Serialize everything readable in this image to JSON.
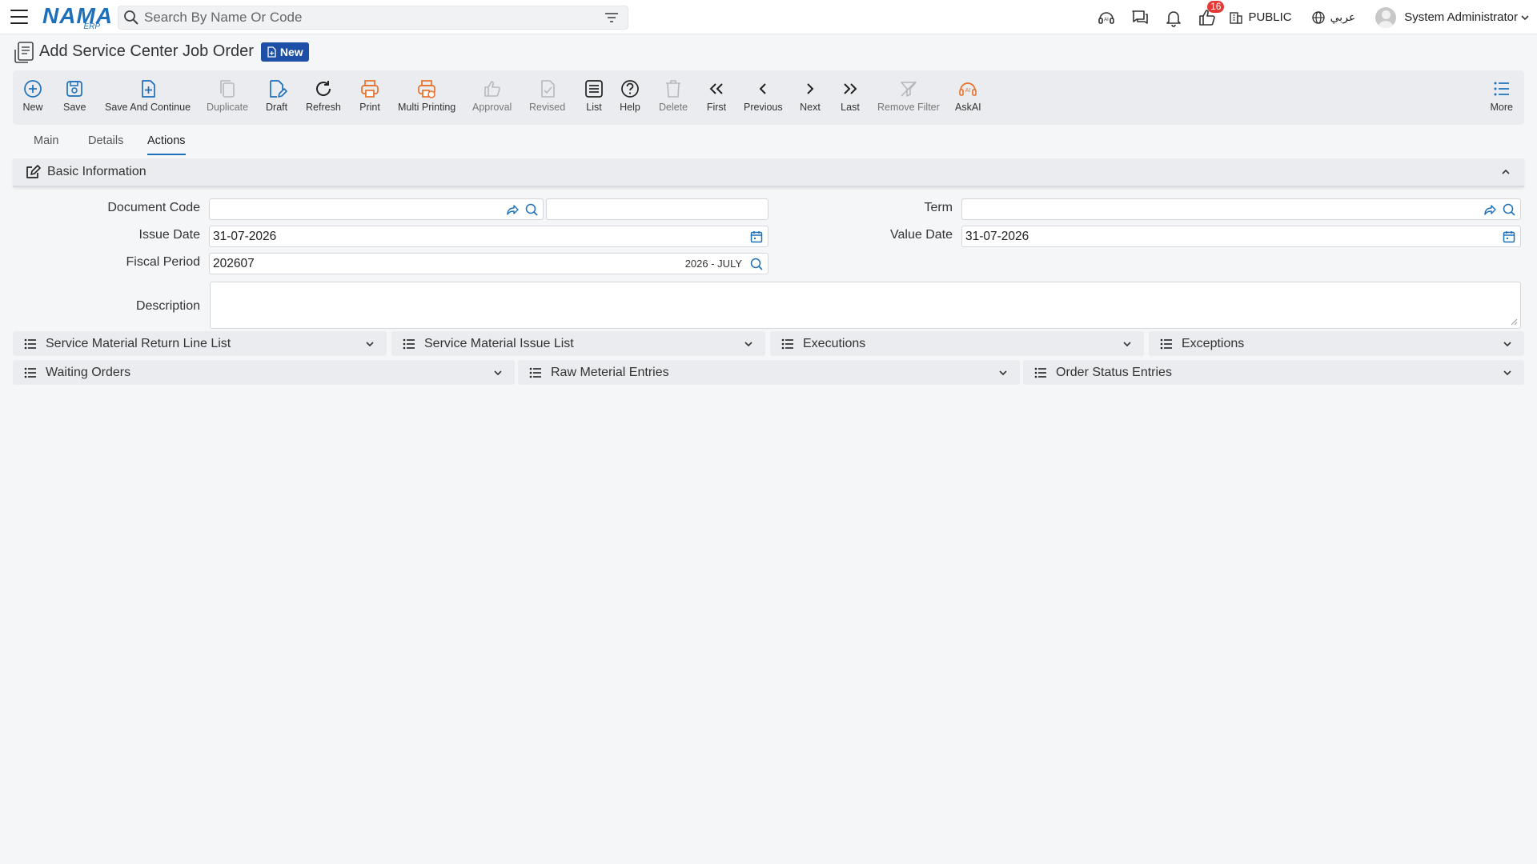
{
  "topbar": {
    "logo_main": "NAMA",
    "logo_sub": "ERP",
    "search_placeholder": "Search By Name Or Code",
    "notification_count": "16",
    "public_label": "PUBLIC",
    "language_label": "عربي",
    "user_name": "System Administrator"
  },
  "page": {
    "title": "Add Service Center Job Order",
    "status_badge": "New"
  },
  "toolbar": {
    "new": "New",
    "save": "Save",
    "save_continue": "Save And Continue",
    "duplicate": "Duplicate",
    "draft": "Draft",
    "refresh": "Refresh",
    "print": "Print",
    "multi_printing": "Multi Printing",
    "approval": "Approval",
    "revised": "Revised",
    "list": "List",
    "help": "Help",
    "delete": "Delete",
    "first": "First",
    "previous": "Previous",
    "next": "Next",
    "last": "Last",
    "remove_filter": "Remove Filter",
    "askai": "AskAI",
    "more": "More"
  },
  "tabs": {
    "main": "Main",
    "details": "Details",
    "actions": "Actions",
    "active": "Actions"
  },
  "basic_info": {
    "title": "Basic Information",
    "document_code_label": "Document Code",
    "document_code_value": "",
    "document_code_name": "",
    "term_label": "Term",
    "term_value": "",
    "issue_date_label": "Issue Date",
    "issue_date_value": "31-07-2026",
    "value_date_label": "Value Date",
    "value_date_value": "31-07-2026",
    "fiscal_period_label": "Fiscal Period",
    "fiscal_period_value": "202607",
    "fiscal_period_desc": "2026 - JULY",
    "description_label": "Description",
    "description_value": ""
  },
  "lists": {
    "row1": [
      "Service Material Return Line List",
      "Service Material Issue List",
      "Executions",
      "Exceptions"
    ],
    "row2": [
      "Waiting Orders",
      "Raw Meterial Entries",
      "Order Status Entries"
    ]
  },
  "colors": {
    "accent": "#1c6fb8",
    "badge_bg": "#1d4fa6",
    "orange": "#e8702a",
    "notification": "#e53935"
  }
}
